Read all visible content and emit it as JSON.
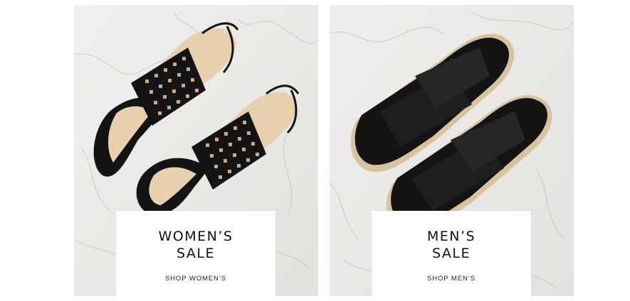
{
  "promos": [
    {
      "title_line1": "WOMEN’S",
      "title_line2": "SALE",
      "link": "SHOP WOMEN’S"
    },
    {
      "title_line1": "MEN’S",
      "title_line2": "SALE",
      "link": "SHOP MEN’S"
    }
  ],
  "colors": {
    "marble": "#e9e8e6",
    "leather": "#141414",
    "insole": "#e8cfae",
    "card": "#ffffff",
    "text": "#111111"
  },
  "icons": {
    "women": "womens-sandals-image",
    "men": "mens-slides-image"
  }
}
